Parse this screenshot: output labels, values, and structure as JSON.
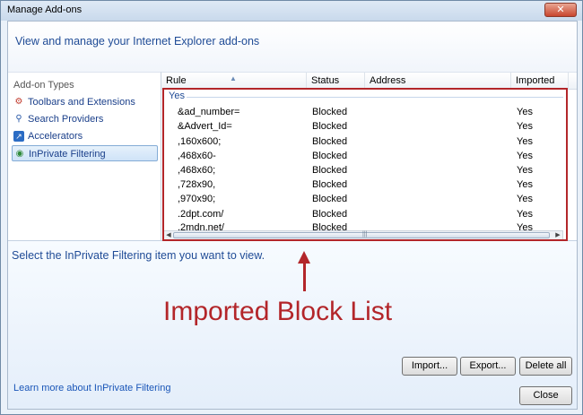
{
  "window": {
    "title": "Manage Add-ons",
    "close_glyph": "✕"
  },
  "header": {
    "text": "View and manage your Internet Explorer add-ons"
  },
  "sidebar": {
    "heading": "Add-on Types",
    "items": [
      {
        "label": "Toolbars and Extensions",
        "icon": "gear-icon"
      },
      {
        "label": "Search Providers",
        "icon": "search-icon"
      },
      {
        "label": "Accelerators",
        "icon": "accelerator-icon"
      },
      {
        "label": "InPrivate Filtering",
        "icon": "inprivate-icon",
        "selected": true
      }
    ]
  },
  "list": {
    "columns": [
      "Rule",
      "Status",
      "Address",
      "Imported"
    ],
    "group_label": "Yes",
    "rows": [
      {
        "rule": "&ad_number=",
        "status": "Blocked",
        "address": "",
        "imported": "Yes"
      },
      {
        "rule": "&Advert_Id=",
        "status": "Blocked",
        "address": "",
        "imported": "Yes"
      },
      {
        "rule": ",160x600;",
        "status": "Blocked",
        "address": "",
        "imported": "Yes"
      },
      {
        "rule": ",468x60-",
        "status": "Blocked",
        "address": "",
        "imported": "Yes"
      },
      {
        "rule": ",468x60;",
        "status": "Blocked",
        "address": "",
        "imported": "Yes"
      },
      {
        "rule": ",728x90,",
        "status": "Blocked",
        "address": "",
        "imported": "Yes"
      },
      {
        "rule": ",970x90;",
        "status": "Blocked",
        "address": "",
        "imported": "Yes"
      },
      {
        "rule": ".2dpt.com/",
        "status": "Blocked",
        "address": "",
        "imported": "Yes"
      },
      {
        "rule": ".2mdn.net/",
        "status": "Blocked",
        "address": "",
        "imported": "Yes"
      }
    ]
  },
  "details": {
    "text": "Select the InPrivate Filtering item you want to view."
  },
  "buttons": {
    "import": "Import...",
    "export": "Export...",
    "delete_all": "Delete all",
    "close": "Close"
  },
  "learn_more": "Learn more about InPrivate Filtering",
  "annotation": "Imported Block List",
  "colors": {
    "accent": "#1f4b96",
    "annotation": "#b3262a"
  }
}
